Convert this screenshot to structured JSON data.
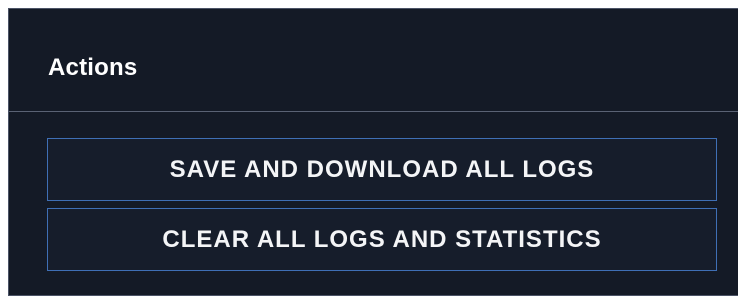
{
  "actions_panel": {
    "title": "Actions",
    "buttons": [
      {
        "label": "SAVE AND DOWNLOAD ALL LOGS"
      },
      {
        "label": "CLEAR ALL LOGS AND STATISTICS"
      }
    ]
  },
  "colors": {
    "panel_background": "#141a26",
    "button_border": "#3f6fb5",
    "text": "#ffffff"
  }
}
